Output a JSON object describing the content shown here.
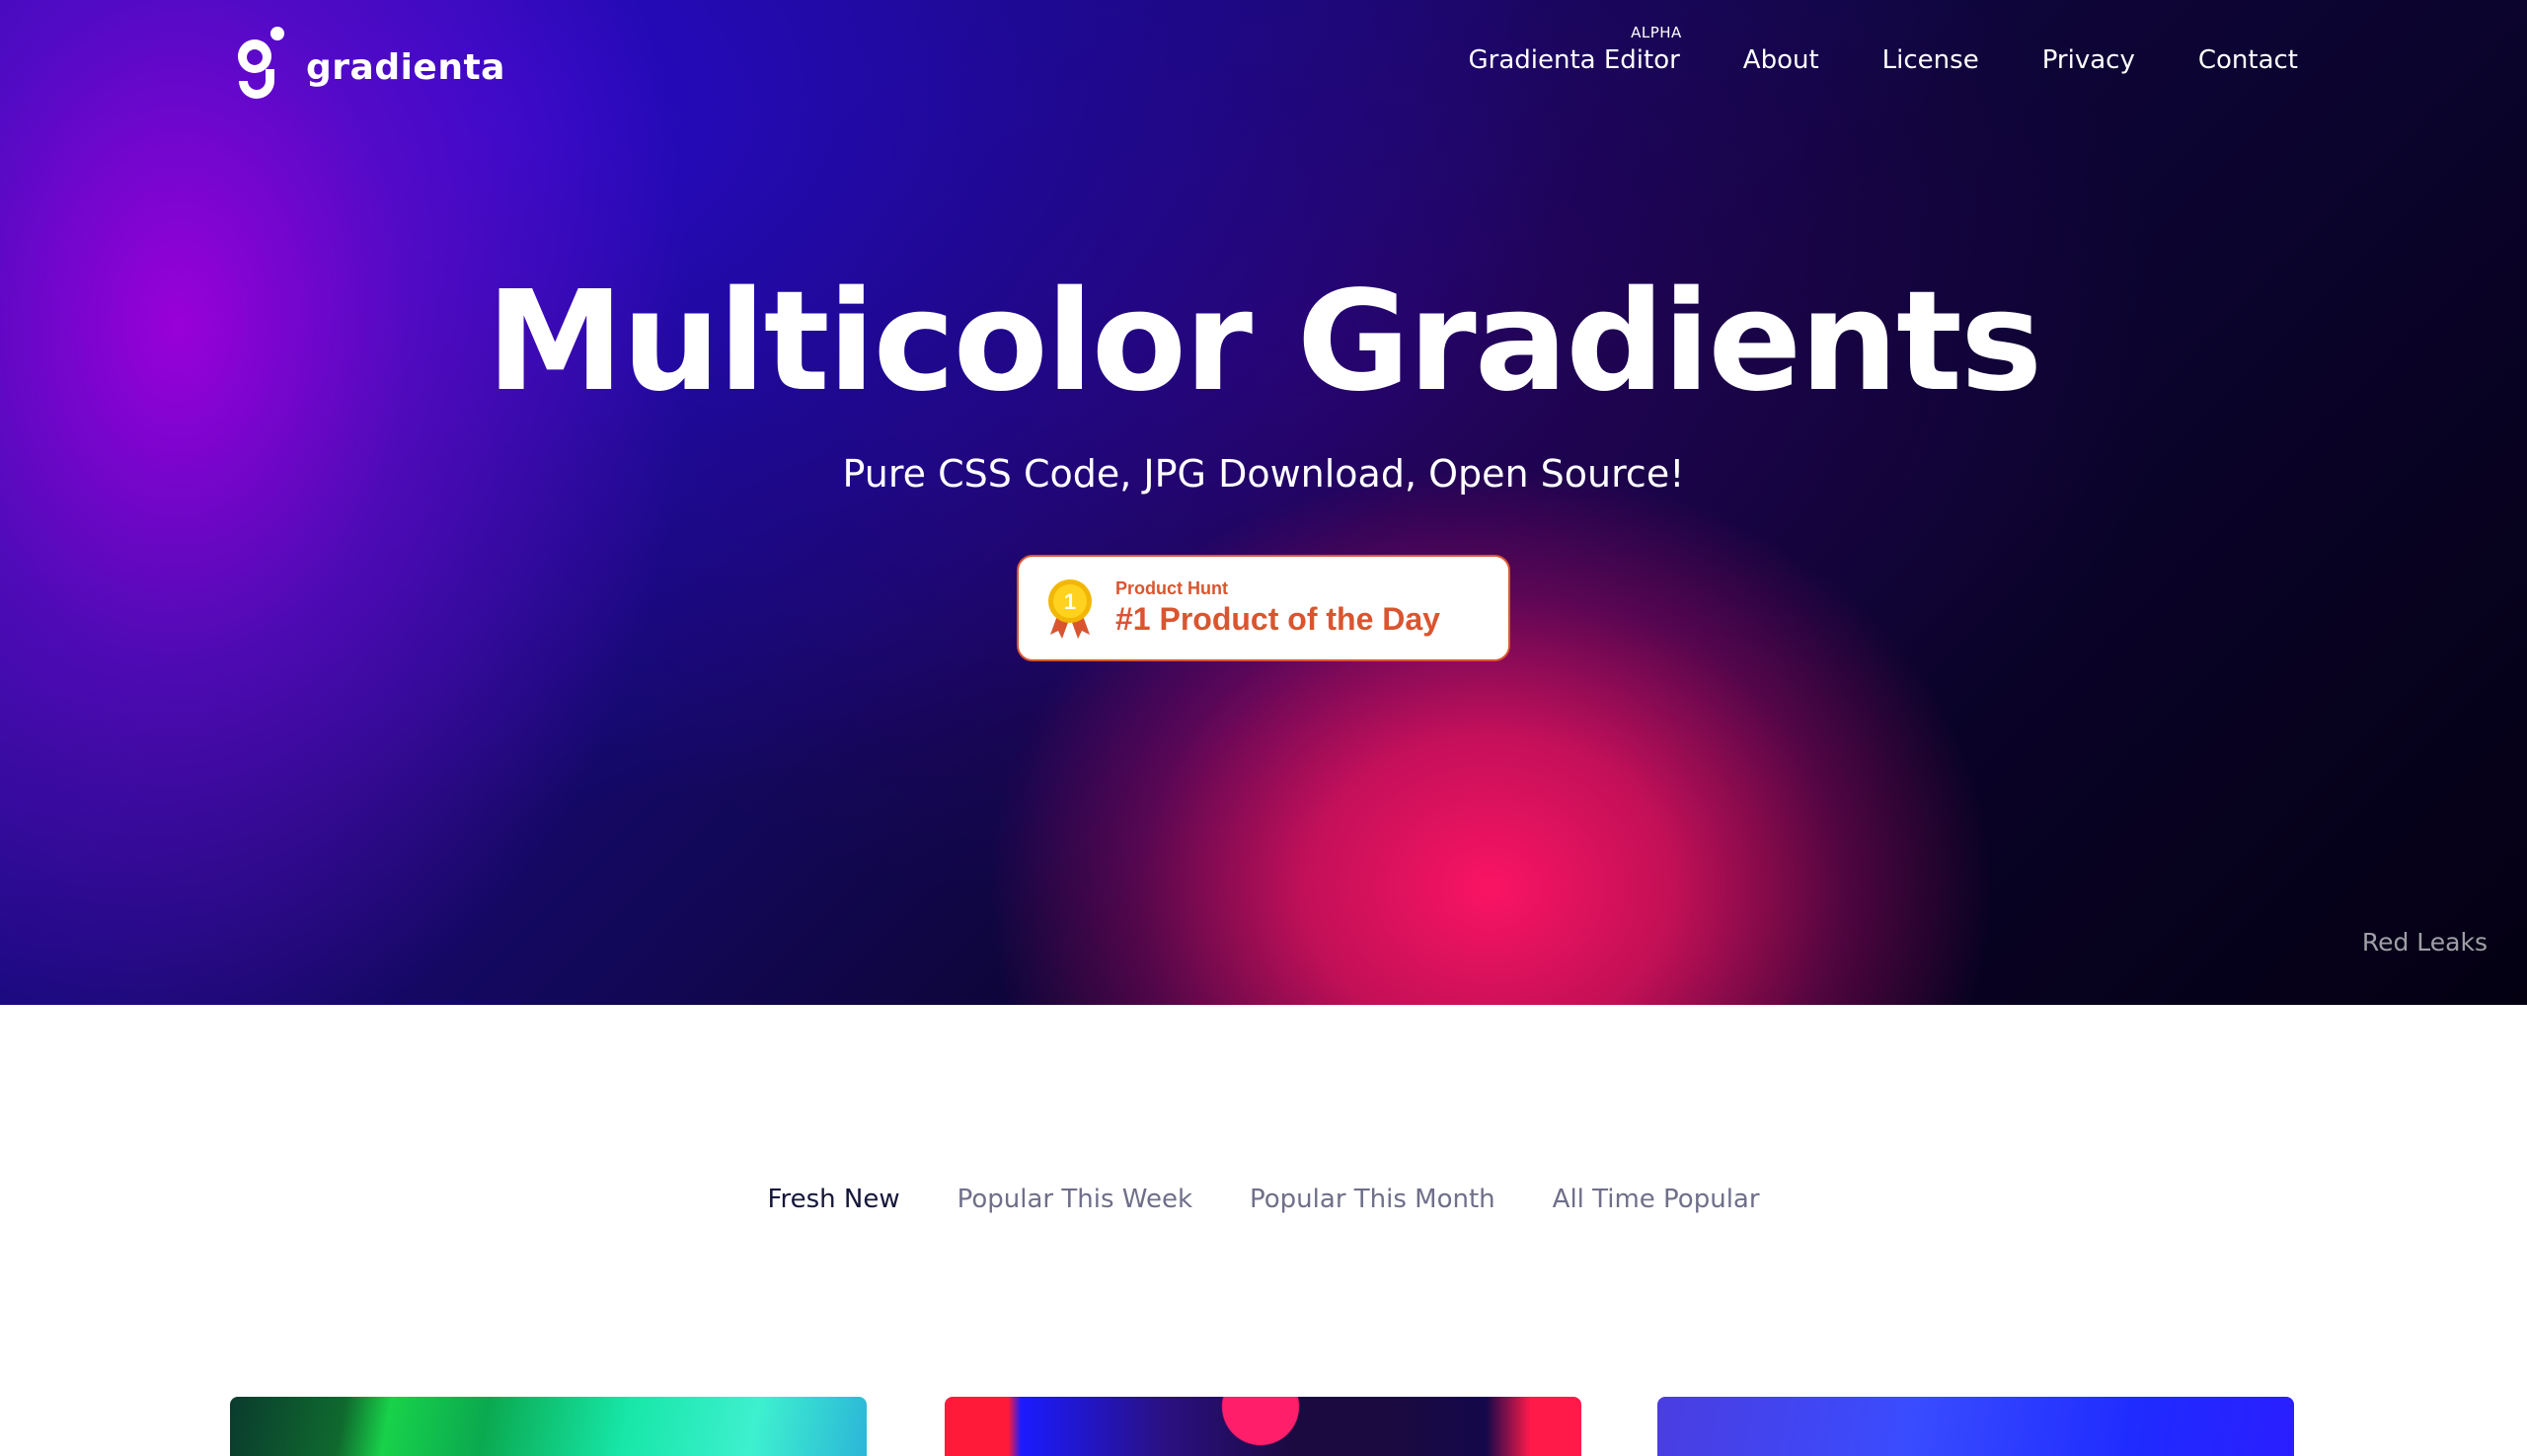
{
  "header": {
    "logo_text": "gradienta",
    "nav": [
      {
        "label": "Gradienta Editor",
        "badge": "ALPHA"
      },
      {
        "label": "About"
      },
      {
        "label": "License"
      },
      {
        "label": "Privacy"
      },
      {
        "label": "Contact"
      }
    ]
  },
  "hero": {
    "title": "Multicolor Gradients",
    "subtitle": "Pure CSS Code, JPG Download, Open Source!",
    "badge": {
      "kicker": "Product Hunt",
      "text": "#1 Product of the Day",
      "medal_number": "1",
      "color": "#da552f"
    },
    "gradient_name": "Red Leaks"
  },
  "tabs": [
    {
      "label": "Fresh New",
      "active": true
    },
    {
      "label": "Popular This Week",
      "active": false
    },
    {
      "label": "Popular This Month",
      "active": false
    },
    {
      "label": "All Time Popular",
      "active": false
    }
  ],
  "colors": {
    "hero_dark": "#0e0538",
    "hero_accent_pink": "#ff1464",
    "hero_accent_purple": "#a000dc",
    "tab_active": "#15163a",
    "tab_inactive": "#6f6f8a"
  }
}
